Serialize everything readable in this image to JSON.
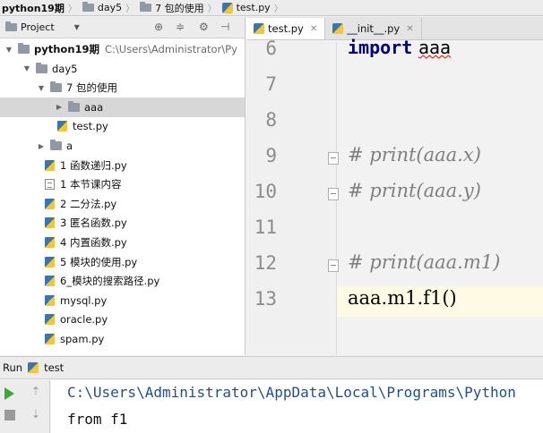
{
  "breadcrumb": [
    "python19期",
    "day5",
    "7 包的使用",
    "test.py"
  ],
  "project_panel": {
    "title": "Project",
    "tree": [
      {
        "label": "python19期",
        "path": "C:\\Users\\Administrator\\Py",
        "kind": "dir",
        "expanded": true,
        "bold": true
      },
      {
        "label": "day5",
        "kind": "dir",
        "expanded": true
      },
      {
        "label": "7 包的使用",
        "kind": "dir",
        "expanded": true
      },
      {
        "label": "aaa",
        "kind": "dir",
        "expanded": false,
        "selected": true
      },
      {
        "label": "test.py",
        "kind": "py"
      },
      {
        "label": "a",
        "kind": "dir",
        "expanded": false
      },
      {
        "label": "1 函数递归.py",
        "kind": "py"
      },
      {
        "label": "1 本节课内容",
        "kind": "txt"
      },
      {
        "label": "2 二分法.py",
        "kind": "py"
      },
      {
        "label": "3 匿名函数.py",
        "kind": "py"
      },
      {
        "label": "4 内置函数.py",
        "kind": "py"
      },
      {
        "label": "5 模块的使用.py",
        "kind": "py"
      },
      {
        "label": "6_模块的搜索路径.py",
        "kind": "py"
      },
      {
        "label": "mysql.py",
        "kind": "py"
      },
      {
        "label": "oracle.py",
        "kind": "py"
      },
      {
        "label": "spam.py",
        "kind": "py"
      }
    ]
  },
  "editor": {
    "tabs": [
      {
        "label": "test.py",
        "active": true
      },
      {
        "label": "__init__.py",
        "active": false
      }
    ],
    "lines": [
      {
        "num": "6",
        "kw": "import",
        "rest": "aaa"
      },
      {
        "num": "7",
        "text": ""
      },
      {
        "num": "8",
        "text": ""
      },
      {
        "num": "9",
        "comment": "# print(aaa.x)"
      },
      {
        "num": "10",
        "comment": "# print(aaa.y)"
      },
      {
        "num": "11",
        "text": ""
      },
      {
        "num": "12",
        "comment": "# print(aaa.m1)"
      },
      {
        "num": "13",
        "text": "aaa.m1.f1()"
      }
    ]
  },
  "run": {
    "label": "Run",
    "config": "test",
    "output": [
      "C:\\Users\\Administrator\\AppData\\Local\\Programs\\Python",
      "from f1"
    ]
  }
}
